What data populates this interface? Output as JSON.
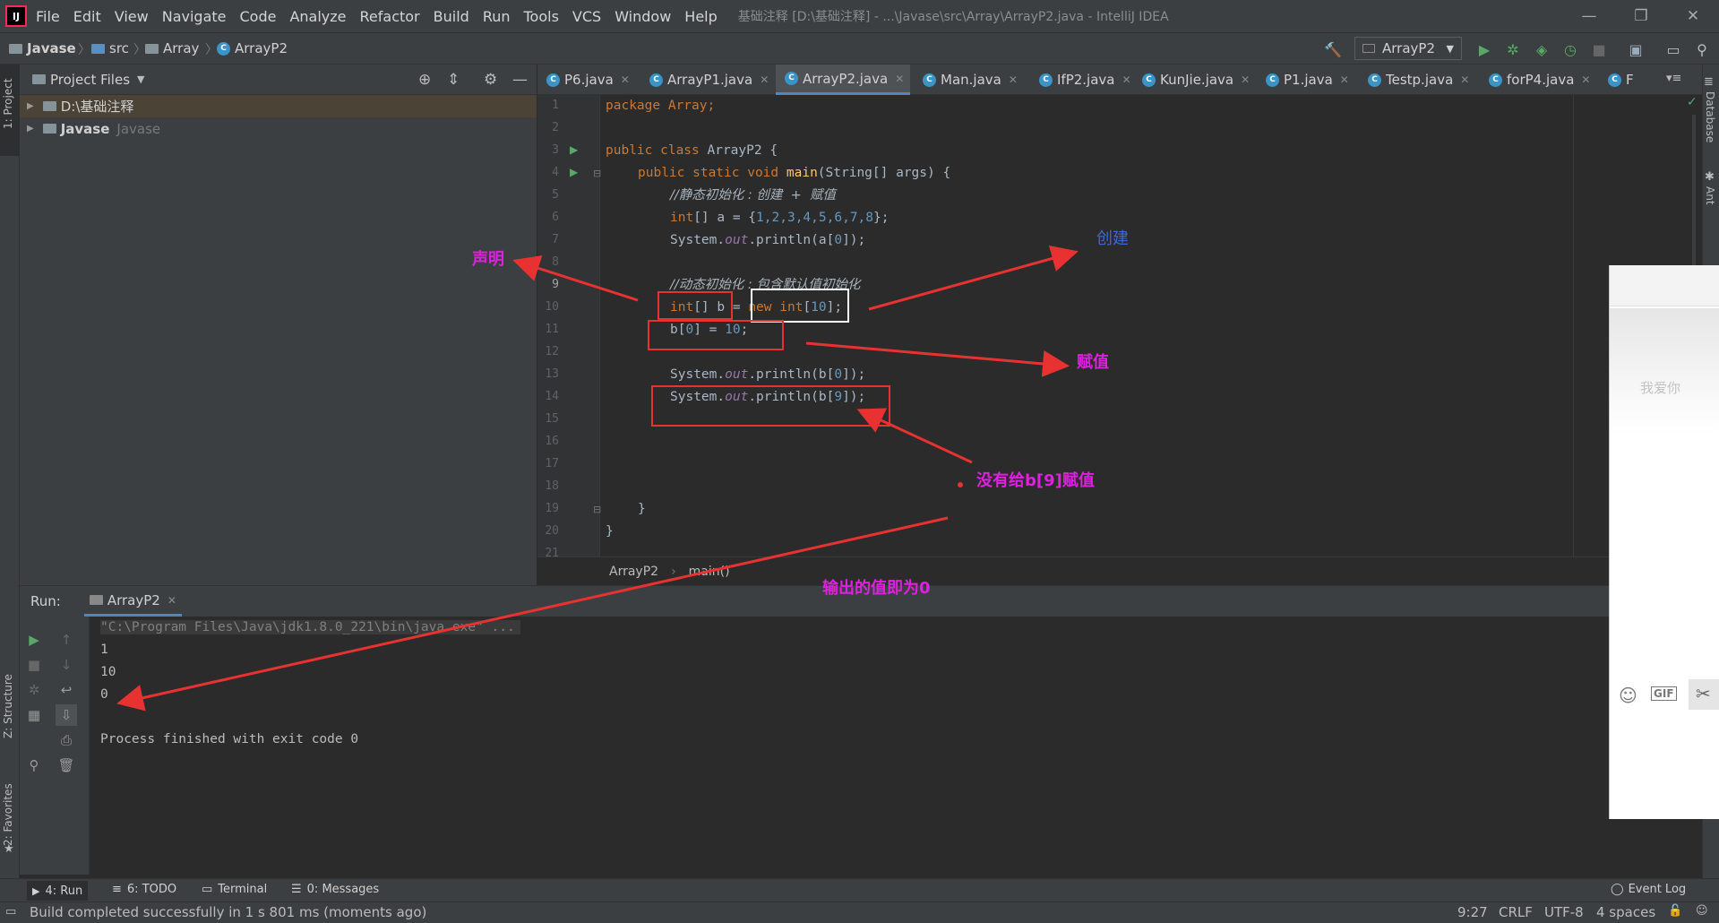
{
  "app": {
    "logo_text": "IJ",
    "window_title": "基础注释 [D:\\基础注释] - ...\\Javase\\src\\Array\\ArrayP2.java - IntelliJ IDEA",
    "menu": [
      "File",
      "Edit",
      "View",
      "Navigate",
      "Code",
      "Analyze",
      "Refactor",
      "Build",
      "Run",
      "Tools",
      "VCS",
      "Window",
      "Help"
    ],
    "window_buttons": {
      "minimize": "—",
      "restore": "❐",
      "close": "✕"
    }
  },
  "navbar": {
    "breadcrumbs": [
      "Javase",
      "src",
      "Array",
      "ArrayP2"
    ],
    "run_config": "ArrayP2"
  },
  "left_strip": {
    "project_tab": "1: Project",
    "structure_tab": "Z: Structure",
    "favorites_tab": "2: Favorites"
  },
  "right_strip": {
    "database_tab": "Database",
    "ant_tab": "Ant"
  },
  "project_panel": {
    "title": "Project Files",
    "tree": [
      {
        "label": "D:\\基础注释",
        "secondary": ""
      },
      {
        "label": "Javase",
        "secondary": "Javase"
      }
    ]
  },
  "editor": {
    "tabs": [
      {
        "label": "P6.java"
      },
      {
        "label": "ArrayP1.java"
      },
      {
        "label": "ArrayP2.java"
      },
      {
        "label": "Man.java"
      },
      {
        "label": "IfP2.java"
      },
      {
        "label": "KunJie.java"
      },
      {
        "label": "P1.java"
      },
      {
        "label": "Testp.java"
      },
      {
        "label": "forP4.java"
      },
      {
        "label": "F"
      }
    ],
    "line_numbers": [
      "1",
      "2",
      "3",
      "4",
      "5",
      "6",
      "7",
      "8",
      "9",
      "10",
      "11",
      "12",
      "13",
      "14",
      "15",
      "16",
      "17",
      "18",
      "19",
      "20",
      "21"
    ],
    "code": {
      "l1": "package Array;",
      "l3_kw": "public class",
      "l3_rest": " ArrayP2 {",
      "l4_kw": "public static void",
      "l4_fn": "main",
      "l4_rest": "(String[] args) {",
      "l5": "//静态初始化 : 创建  +  赋值",
      "l6_a": "int",
      "l6_b": "[] a = {",
      "l6_nums": "1,2,3,4,5,6,7,8",
      "l6_c": "};",
      "l7_a": "System.",
      "l7_out": "out",
      "l7_b": ".println(a[",
      "l7_n": "0",
      "l7_c": "]);",
      "l9": "//动态初始化 : 包含默认值初始化",
      "l10_a": "int",
      "l10_b": "[] b = ",
      "l10_new": "new ",
      "l10_int": "int",
      "l10_c": "[",
      "l10_n": "10",
      "l10_d": "];",
      "l11_a": "b[",
      "l11_n1": "0",
      "l11_b": "] = ",
      "l11_n2": "10",
      "l11_c": ";",
      "l13_a": "System.",
      "l13_out": "out",
      "l13_b": ".println(b[",
      "l13_n": "0",
      "l13_c": "]);",
      "l14_a": "System.",
      "l14_out": "out",
      "l14_b": ".println(b[",
      "l14_n": "9",
      "l14_c": "]);",
      "l19": "}",
      "l20": "}"
    },
    "breadcrumb": [
      "ArrayP2",
      "main()"
    ]
  },
  "run_panel": {
    "label": "Run:",
    "tab": "ArrayP2",
    "output": [
      "\"C:\\Program Files\\Java\\jdk1.8.0_221\\bin\\java.exe\" ...",
      "1",
      "10",
      "0",
      "",
      "Process finished with exit code 0"
    ]
  },
  "bottom_tabs": [
    {
      "label": "4: Run"
    },
    {
      "label": "6: TODO"
    },
    {
      "label": "Terminal"
    },
    {
      "label": "0: Messages"
    }
  ],
  "event_log": "Event Log",
  "status": {
    "message": "Build completed successfully in 1 s 801 ms (moments ago)",
    "position": "9:27",
    "line_sep": "CRLF",
    "encoding": "UTF-8",
    "indent": "4 spaces"
  },
  "annotations": {
    "declare": "声明",
    "create": "创建",
    "assign": "赋值",
    "not_assigned": "没有给b[9]赋值",
    "output_zero": "输出的值即为0"
  },
  "float_panel": {
    "faint_text": "我爱你"
  },
  "colors": {
    "annotation_magenta": "#e020e0",
    "annotation_blue": "#3a6ad8",
    "arrow_red": "#e83232",
    "run_green": "#59a869",
    "accent_blue": "#4a88c7"
  }
}
